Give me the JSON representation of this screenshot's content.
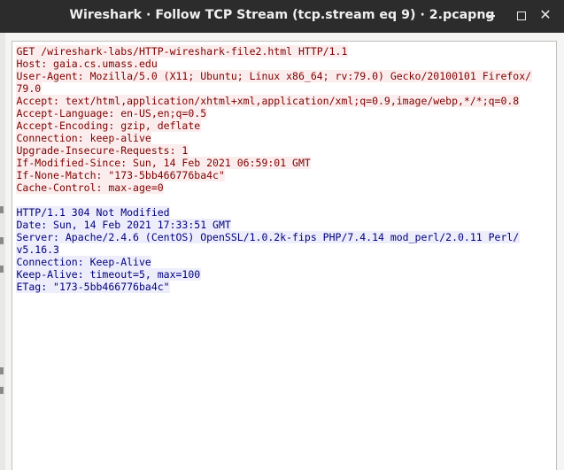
{
  "window": {
    "title": "Wireshark · Follow TCP Stream (tcp.stream eq 9) · 2.pcapng",
    "close_glyph": "✕"
  },
  "stream": {
    "client_lines": [
      "GET /wireshark-labs/HTTP-wireshark-file2.html HTTP/1.1",
      "Host: gaia.cs.umass.edu",
      "User-Agent: Mozilla/5.0 (X11; Ubuntu; Linux x86_64; rv:79.0) Gecko/20100101 Firefox/",
      "79.0",
      "Accept: text/html,application/xhtml+xml,application/xml;q=0.9,image/webp,*/*;q=0.8",
      "Accept-Language: en-US,en;q=0.5",
      "Accept-Encoding: gzip, deflate",
      "Connection: keep-alive",
      "Upgrade-Insecure-Requests: 1",
      "If-Modified-Since: Sun, 14 Feb 2021 06:59:01 GMT",
      "If-None-Match: \"173-5bb466776ba4c\"",
      "Cache-Control: max-age=0"
    ],
    "server_lines": [
      "HTTP/1.1 304 Not Modified",
      "Date: Sun, 14 Feb 2021 17:33:51 GMT",
      "Server: Apache/2.4.6 (CentOS) OpenSSL/1.0.2k-fips PHP/7.4.14 mod_perl/2.0.11 Perl/",
      "v5.16.3",
      "Connection: Keep-Alive",
      "Keep-Alive: timeout=5, max=100",
      "ETag: \"173-5bb466776ba4c\""
    ]
  },
  "colors": {
    "client_text": "#7f0000",
    "client_bg": "#fbeded",
    "server_text": "#00007f",
    "server_bg": "#ededfb"
  }
}
